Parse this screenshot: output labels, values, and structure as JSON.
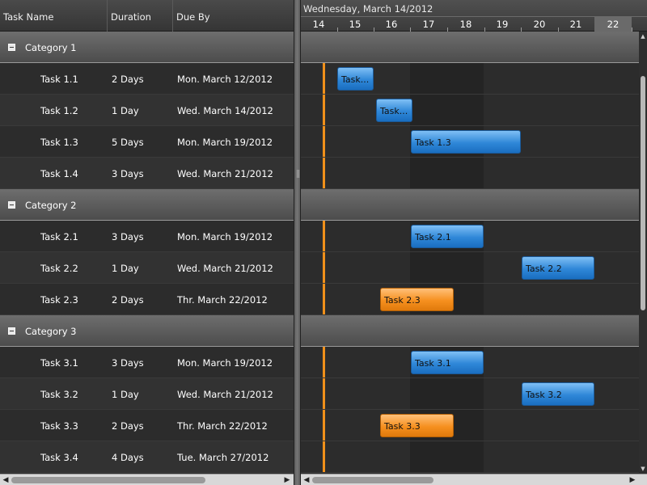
{
  "columns": {
    "task_name": "Task Name",
    "duration": "Duration",
    "due_by": "Due By"
  },
  "timeline": {
    "header_date": "Wednesday, March 14/2012",
    "days": [
      "14",
      "15",
      "16",
      "17",
      "18",
      "19",
      "20",
      "21",
      "22"
    ],
    "weekend_day": "22"
  },
  "categories": [
    {
      "label": "Category 1",
      "tasks": [
        {
          "name": "Task 1.1",
          "duration": "2 Days",
          "due": "Mon. March 12/2012",
          "bar_label": "Task...",
          "bar_color": "blue"
        },
        {
          "name": "Task 1.2",
          "duration": "1 Day",
          "due": "Wed. March 14/2012",
          "bar_label": "Task...",
          "bar_color": "blue"
        },
        {
          "name": "Task 1.3",
          "duration": "5 Days",
          "due": "Mon. March 19/2012",
          "bar_label": "Task 1.3",
          "bar_color": "blue"
        },
        {
          "name": "Task 1.4",
          "duration": "3 Days",
          "due": "Wed. March 21/2012",
          "bar_label": "",
          "bar_color": "none"
        }
      ]
    },
    {
      "label": "Category 2",
      "tasks": [
        {
          "name": "Task 2.1",
          "duration": "3 Days",
          "due": "Mon. March 19/2012",
          "bar_label": "Task 2.1",
          "bar_color": "blue"
        },
        {
          "name": "Task 2.2",
          "duration": "1 Day",
          "due": "Wed. March 21/2012",
          "bar_label": "Task 2.2",
          "bar_color": "blue"
        },
        {
          "name": "Task 2.3",
          "duration": "2 Days",
          "due": "Thr. March 22/2012",
          "bar_label": "Task 2.3",
          "bar_color": "orange"
        }
      ]
    },
    {
      "label": "Category 3",
      "tasks": [
        {
          "name": "Task 3.1",
          "duration": "3 Days",
          "due": "Mon. March 19/2012",
          "bar_label": "Task 3.1",
          "bar_color": "blue"
        },
        {
          "name": "Task 3.2",
          "duration": "1 Day",
          "due": "Wed. March 21/2012",
          "bar_label": "Task 3.2",
          "bar_color": "blue"
        },
        {
          "name": "Task 3.3",
          "duration": "2 Days",
          "due": "Thr. March 22/2012",
          "bar_label": "Task 3.3",
          "bar_color": "orange"
        },
        {
          "name": "Task 3.4",
          "duration": "4 Days",
          "due": "Tue. March 27/2012",
          "bar_label": "",
          "bar_color": "none"
        }
      ]
    }
  ],
  "colors": {
    "bar_blue": "#2f87d8",
    "bar_orange": "#f6901f",
    "today_line": "#f0901a"
  },
  "icons": {
    "collapse": "collapse-icon",
    "scroll_left": "◀",
    "scroll_right": "▶",
    "scroll_up": "▲",
    "scroll_down": "▼"
  }
}
